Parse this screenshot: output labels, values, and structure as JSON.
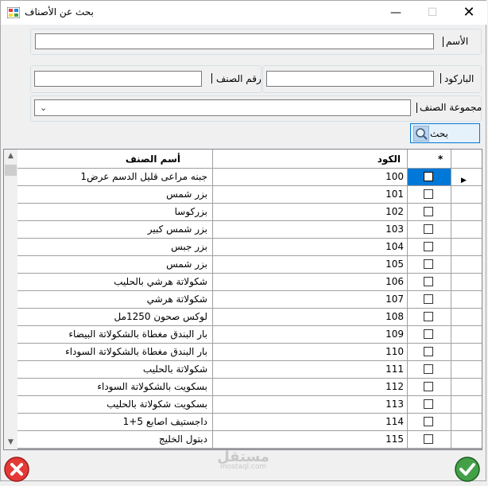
{
  "window": {
    "title": "بحث عن الأصناف",
    "minimize_glyph": "—",
    "maximize_glyph": "☐",
    "close_glyph": "✕"
  },
  "filters": {
    "name_label": "الأسم",
    "barcode_label": "الباركود",
    "item_number_label": "رقم الصنف",
    "group_label": "مجموعة الصنف",
    "combo_arrow": "⌄",
    "name_value": "",
    "barcode_value": "",
    "item_number_value": "",
    "group_value": ""
  },
  "search_button": {
    "label": "بحث"
  },
  "grid": {
    "headers": {
      "name": "أسم الصنف",
      "code": "الكود",
      "select": "*"
    },
    "rows": [
      {
        "code": "100",
        "name": "جبنه مراعى قليل الدسم عرض1",
        "checked": false,
        "selected": true
      },
      {
        "code": "101",
        "name": "بزر شمس",
        "checked": false
      },
      {
        "code": "102",
        "name": "بزركوسا",
        "checked": false
      },
      {
        "code": "103",
        "name": "بزر شمس كبير",
        "checked": false
      },
      {
        "code": "104",
        "name": "بزر جبس",
        "checked": false
      },
      {
        "code": "105",
        "name": "بزر شمس",
        "checked": false
      },
      {
        "code": "106",
        "name": "شكولاتة هرشي بالحليب",
        "checked": false
      },
      {
        "code": "107",
        "name": "شكولاتة هرشي",
        "checked": false
      },
      {
        "code": "108",
        "name": "لوكس صحون 1250مل",
        "checked": false
      },
      {
        "code": "109",
        "name": "بار البندق مغطاة بالشكولاتة البيضاء",
        "checked": false
      },
      {
        "code": "110",
        "name": "بار البندق مغطاة بالشكولاتة السوداء",
        "checked": false
      },
      {
        "code": "111",
        "name": "شكولاتة بالحليب",
        "checked": false
      },
      {
        "code": "112",
        "name": "بسكويت بالشكولاتة السوداء",
        "checked": false
      },
      {
        "code": "113",
        "name": "بسكويت شكولاتة بالحليب",
        "checked": false
      },
      {
        "code": "114",
        "name": "داجستيف اصابع 5+1",
        "checked": false
      },
      {
        "code": "115",
        "name": "دبتول الخليج",
        "checked": false
      }
    ],
    "current_row_indicator": "▶"
  },
  "scrollbar": {
    "up_glyph": "▲",
    "down_glyph": "▼"
  },
  "watermark": {
    "text": "مستقل",
    "sub": "mostaql.com"
  },
  "colors": {
    "selection": "#0078d7",
    "cancel": "#e53935",
    "ok": "#43a047"
  }
}
